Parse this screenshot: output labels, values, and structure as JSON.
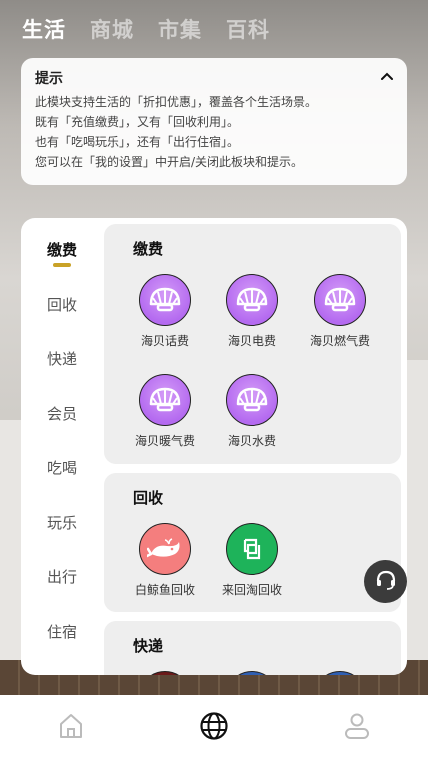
{
  "top_tabs": [
    {
      "label": "生活",
      "active": true
    },
    {
      "label": "商城",
      "active": false
    },
    {
      "label": "市集",
      "active": false
    },
    {
      "label": "百科",
      "active": false
    }
  ],
  "tip": {
    "title": "提示",
    "lines": [
      "此模块支持生活的「折扣优惠」，覆盖各个生活场景。",
      "既有「充值缴费」，又有「回收利用」。",
      "也有「吃喝玩乐」，还有「出行住宿」。",
      "您可以在「我的设置」中开启/关闭此板块和提示。"
    ]
  },
  "sidebar": {
    "items": [
      {
        "label": "缴费",
        "active": true
      },
      {
        "label": "回收",
        "active": false
      },
      {
        "label": "快递",
        "active": false
      },
      {
        "label": "会员",
        "active": false
      },
      {
        "label": "吃喝",
        "active": false
      },
      {
        "label": "玩乐",
        "active": false
      },
      {
        "label": "出行",
        "active": false
      },
      {
        "label": "住宿",
        "active": false
      }
    ]
  },
  "sections": [
    {
      "title": "缴费",
      "services": [
        {
          "label": "海贝话费",
          "icon": "shell-icon"
        },
        {
          "label": "海贝电费",
          "icon": "shell-icon"
        },
        {
          "label": "海贝燃气费",
          "icon": "shell-icon"
        },
        {
          "label": "海贝暖气费",
          "icon": "shell-icon"
        },
        {
          "label": "海贝水费",
          "icon": "shell-icon"
        }
      ]
    },
    {
      "title": "回收",
      "services": [
        {
          "label": "白鲸鱼回收",
          "icon": "whale-icon"
        },
        {
          "label": "来回淘回收",
          "icon": "recycle-box-icon"
        }
      ]
    },
    {
      "title": "快递",
      "services": []
    }
  ],
  "colors": {
    "accent_indicator": "#c9a227",
    "shell_purple": "#b46af0",
    "whale_pink": "#f47e7e",
    "recycle_green": "#1eb35a"
  },
  "bottom_nav": [
    {
      "icon": "home-icon",
      "active": false
    },
    {
      "icon": "globe-icon",
      "active": true
    },
    {
      "icon": "profile-icon",
      "active": false
    }
  ]
}
